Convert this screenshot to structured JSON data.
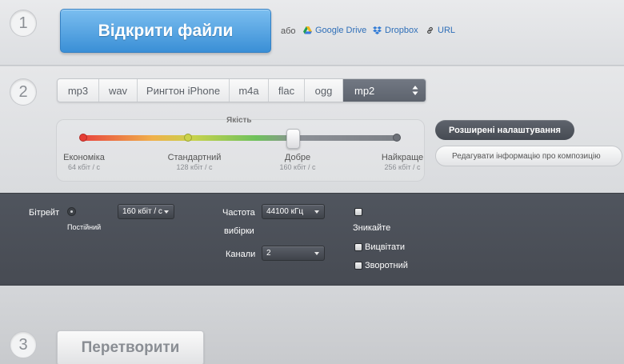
{
  "steps": {
    "one": "1",
    "two": "2",
    "three": "3"
  },
  "open": {
    "button_label": "Відкрити файли",
    "or_label": "або",
    "sources": [
      "Google Drive",
      "Dropbox",
      "URL"
    ]
  },
  "formats": {
    "tabs": [
      "mp3",
      "wav",
      "Рингтон iPhone",
      "m4a",
      "flac",
      "ogg"
    ],
    "selected": "mp2"
  },
  "quality": {
    "title": "Якість",
    "selected_level": "Добре",
    "levels": [
      {
        "name": "Економіка",
        "bitrate": "64 кбіт / с"
      },
      {
        "name": "Стандартний",
        "bitrate": "128 кбіт / с"
      },
      {
        "name": "Добре",
        "bitrate": "160 кбіт / с"
      },
      {
        "name": "Найкраще",
        "bitrate": "256 кбіт / с"
      }
    ]
  },
  "settings": {
    "advanced_label": "Розширені налаштування",
    "edit_info_label": "Редагувати інформацію про композицію"
  },
  "advanced": {
    "bitrate_label": "Бітрейт",
    "constant_label": "Постійний",
    "bitrate_value": "160 кбіт / с",
    "frequency_label_1": "Частота",
    "frequency_label_2": "вибірки",
    "frequency_value": "44100 кГц",
    "channels_label": "Канали",
    "channels_value": "2",
    "fade_label": "Зникайте",
    "fade_in_label": "Вицвітати",
    "reverse_label": "Зворотний"
  },
  "convert": {
    "button_label": "Перетворити"
  },
  "colors": {
    "accent_blue": "#3a8fd6",
    "dark_panel": "#4b4f57"
  }
}
